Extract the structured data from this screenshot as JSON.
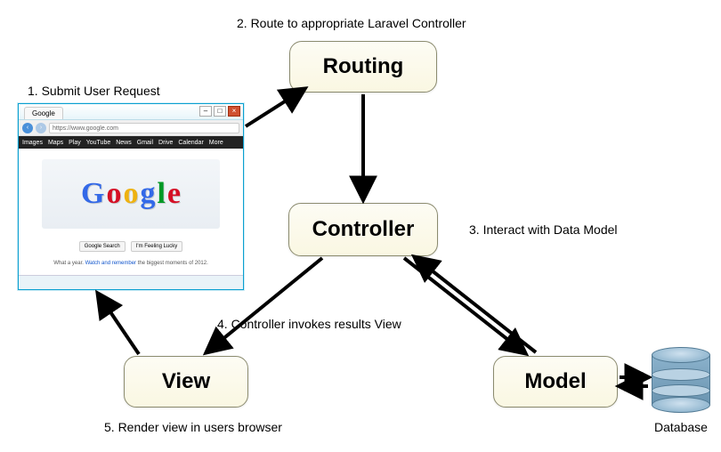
{
  "nodes": {
    "routing": "Routing",
    "controller": "Controller",
    "view": "View",
    "model": "Model",
    "database": "Database"
  },
  "steps": {
    "s1": "1. Submit User Request",
    "s2": "2. Route to appropriate Laravel Controller",
    "s3": "3. Interact with Data Model",
    "s4": "4. Controller invokes results View",
    "s5": "5. Render view in users browser"
  },
  "browser": {
    "tab": "Google",
    "url": "https://www.google.com",
    "menu": [
      "Images",
      "Maps",
      "Play",
      "YouTube",
      "News",
      "Gmail",
      "Drive",
      "Calendar",
      "More"
    ],
    "doodle_letters": [
      {
        "ch": "G",
        "color": "#3369e8"
      },
      {
        "ch": "o",
        "color": "#d50f25"
      },
      {
        "ch": "o",
        "color": "#eeb211"
      },
      {
        "ch": "g",
        "color": "#3369e8"
      },
      {
        "ch": "l",
        "color": "#009925"
      },
      {
        "ch": "e",
        "color": "#d50f25"
      }
    ],
    "btn_search": "Google Search",
    "btn_lucky": "I'm Feeling Lucky",
    "footer_pre": "What a year.",
    "footer_link": "Watch and remember",
    "footer_post": "the biggest moments of 2012."
  }
}
